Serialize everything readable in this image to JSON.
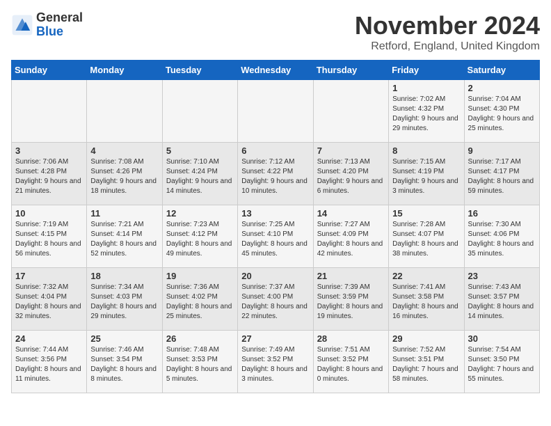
{
  "header": {
    "logo_general": "General",
    "logo_blue": "Blue",
    "month_title": "November 2024",
    "location": "Retford, England, United Kingdom"
  },
  "days_of_week": [
    "Sunday",
    "Monday",
    "Tuesday",
    "Wednesday",
    "Thursday",
    "Friday",
    "Saturday"
  ],
  "weeks": [
    [
      {
        "day": "",
        "info": ""
      },
      {
        "day": "",
        "info": ""
      },
      {
        "day": "",
        "info": ""
      },
      {
        "day": "",
        "info": ""
      },
      {
        "day": "",
        "info": ""
      },
      {
        "day": "1",
        "info": "Sunrise: 7:02 AM\nSunset: 4:32 PM\nDaylight: 9 hours and 29 minutes."
      },
      {
        "day": "2",
        "info": "Sunrise: 7:04 AM\nSunset: 4:30 PM\nDaylight: 9 hours and 25 minutes."
      }
    ],
    [
      {
        "day": "3",
        "info": "Sunrise: 7:06 AM\nSunset: 4:28 PM\nDaylight: 9 hours and 21 minutes."
      },
      {
        "day": "4",
        "info": "Sunrise: 7:08 AM\nSunset: 4:26 PM\nDaylight: 9 hours and 18 minutes."
      },
      {
        "day": "5",
        "info": "Sunrise: 7:10 AM\nSunset: 4:24 PM\nDaylight: 9 hours and 14 minutes."
      },
      {
        "day": "6",
        "info": "Sunrise: 7:12 AM\nSunset: 4:22 PM\nDaylight: 9 hours and 10 minutes."
      },
      {
        "day": "7",
        "info": "Sunrise: 7:13 AM\nSunset: 4:20 PM\nDaylight: 9 hours and 6 minutes."
      },
      {
        "day": "8",
        "info": "Sunrise: 7:15 AM\nSunset: 4:19 PM\nDaylight: 9 hours and 3 minutes."
      },
      {
        "day": "9",
        "info": "Sunrise: 7:17 AM\nSunset: 4:17 PM\nDaylight: 8 hours and 59 minutes."
      }
    ],
    [
      {
        "day": "10",
        "info": "Sunrise: 7:19 AM\nSunset: 4:15 PM\nDaylight: 8 hours and 56 minutes."
      },
      {
        "day": "11",
        "info": "Sunrise: 7:21 AM\nSunset: 4:14 PM\nDaylight: 8 hours and 52 minutes."
      },
      {
        "day": "12",
        "info": "Sunrise: 7:23 AM\nSunset: 4:12 PM\nDaylight: 8 hours and 49 minutes."
      },
      {
        "day": "13",
        "info": "Sunrise: 7:25 AM\nSunset: 4:10 PM\nDaylight: 8 hours and 45 minutes."
      },
      {
        "day": "14",
        "info": "Sunrise: 7:27 AM\nSunset: 4:09 PM\nDaylight: 8 hours and 42 minutes."
      },
      {
        "day": "15",
        "info": "Sunrise: 7:28 AM\nSunset: 4:07 PM\nDaylight: 8 hours and 38 minutes."
      },
      {
        "day": "16",
        "info": "Sunrise: 7:30 AM\nSunset: 4:06 PM\nDaylight: 8 hours and 35 minutes."
      }
    ],
    [
      {
        "day": "17",
        "info": "Sunrise: 7:32 AM\nSunset: 4:04 PM\nDaylight: 8 hours and 32 minutes."
      },
      {
        "day": "18",
        "info": "Sunrise: 7:34 AM\nSunset: 4:03 PM\nDaylight: 8 hours and 29 minutes."
      },
      {
        "day": "19",
        "info": "Sunrise: 7:36 AM\nSunset: 4:02 PM\nDaylight: 8 hours and 25 minutes."
      },
      {
        "day": "20",
        "info": "Sunrise: 7:37 AM\nSunset: 4:00 PM\nDaylight: 8 hours and 22 minutes."
      },
      {
        "day": "21",
        "info": "Sunrise: 7:39 AM\nSunset: 3:59 PM\nDaylight: 8 hours and 19 minutes."
      },
      {
        "day": "22",
        "info": "Sunrise: 7:41 AM\nSunset: 3:58 PM\nDaylight: 8 hours and 16 minutes."
      },
      {
        "day": "23",
        "info": "Sunrise: 7:43 AM\nSunset: 3:57 PM\nDaylight: 8 hours and 14 minutes."
      }
    ],
    [
      {
        "day": "24",
        "info": "Sunrise: 7:44 AM\nSunset: 3:56 PM\nDaylight: 8 hours and 11 minutes."
      },
      {
        "day": "25",
        "info": "Sunrise: 7:46 AM\nSunset: 3:54 PM\nDaylight: 8 hours and 8 minutes."
      },
      {
        "day": "26",
        "info": "Sunrise: 7:48 AM\nSunset: 3:53 PM\nDaylight: 8 hours and 5 minutes."
      },
      {
        "day": "27",
        "info": "Sunrise: 7:49 AM\nSunset: 3:52 PM\nDaylight: 8 hours and 3 minutes."
      },
      {
        "day": "28",
        "info": "Sunrise: 7:51 AM\nSunset: 3:52 PM\nDaylight: 8 hours and 0 minutes."
      },
      {
        "day": "29",
        "info": "Sunrise: 7:52 AM\nSunset: 3:51 PM\nDaylight: 7 hours and 58 minutes."
      },
      {
        "day": "30",
        "info": "Sunrise: 7:54 AM\nSunset: 3:50 PM\nDaylight: 7 hours and 55 minutes."
      }
    ]
  ]
}
